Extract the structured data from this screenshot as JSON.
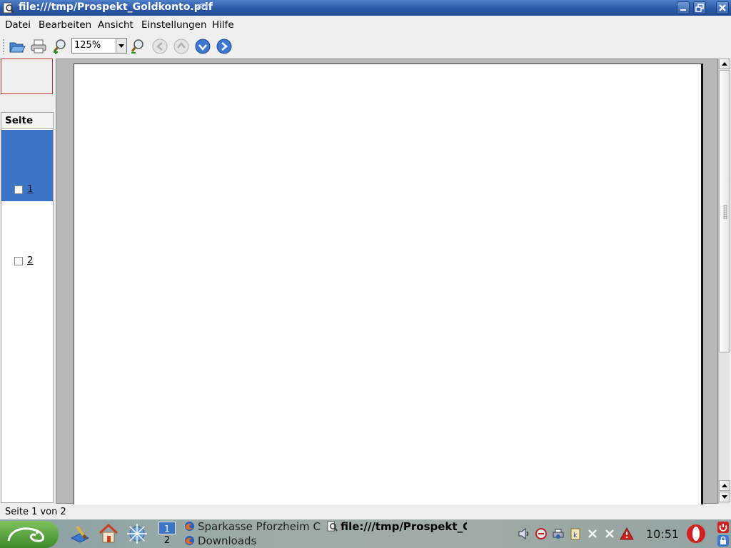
{
  "window": {
    "title": "file:///tmp/Prospekt_Goldkonto.pdf"
  },
  "menu": [
    "Datei",
    "Bearbeiten",
    "Ansicht",
    "Einstellungen",
    "Hilfe"
  ],
  "toolbar": {
    "zoom_value": "125%"
  },
  "toc": {
    "header": "Seite",
    "pages": [
      {
        "label": "1",
        "selected": true
      },
      {
        "label": "2",
        "selected": false
      }
    ]
  },
  "statusbar": {
    "text": "Seite 1 von 2"
  },
  "taskbar": {
    "pager": [
      "1",
      "2"
    ],
    "tasks": [
      {
        "label": "Sparkasse Pforzheim C",
        "icon": "firefox-icon"
      },
      {
        "label": "Downloads",
        "icon": "firefox-icon"
      },
      {
        "label": "file:///tmp/Prospekt_G",
        "icon": "kpdf-icon",
        "active": true
      }
    ],
    "clock": "10:51"
  },
  "colors": {
    "titlebar": "#2d5aa8",
    "selection": "#3c74c8",
    "page_bg": "#ffffff",
    "doc_bg": "#b8b8b8"
  }
}
